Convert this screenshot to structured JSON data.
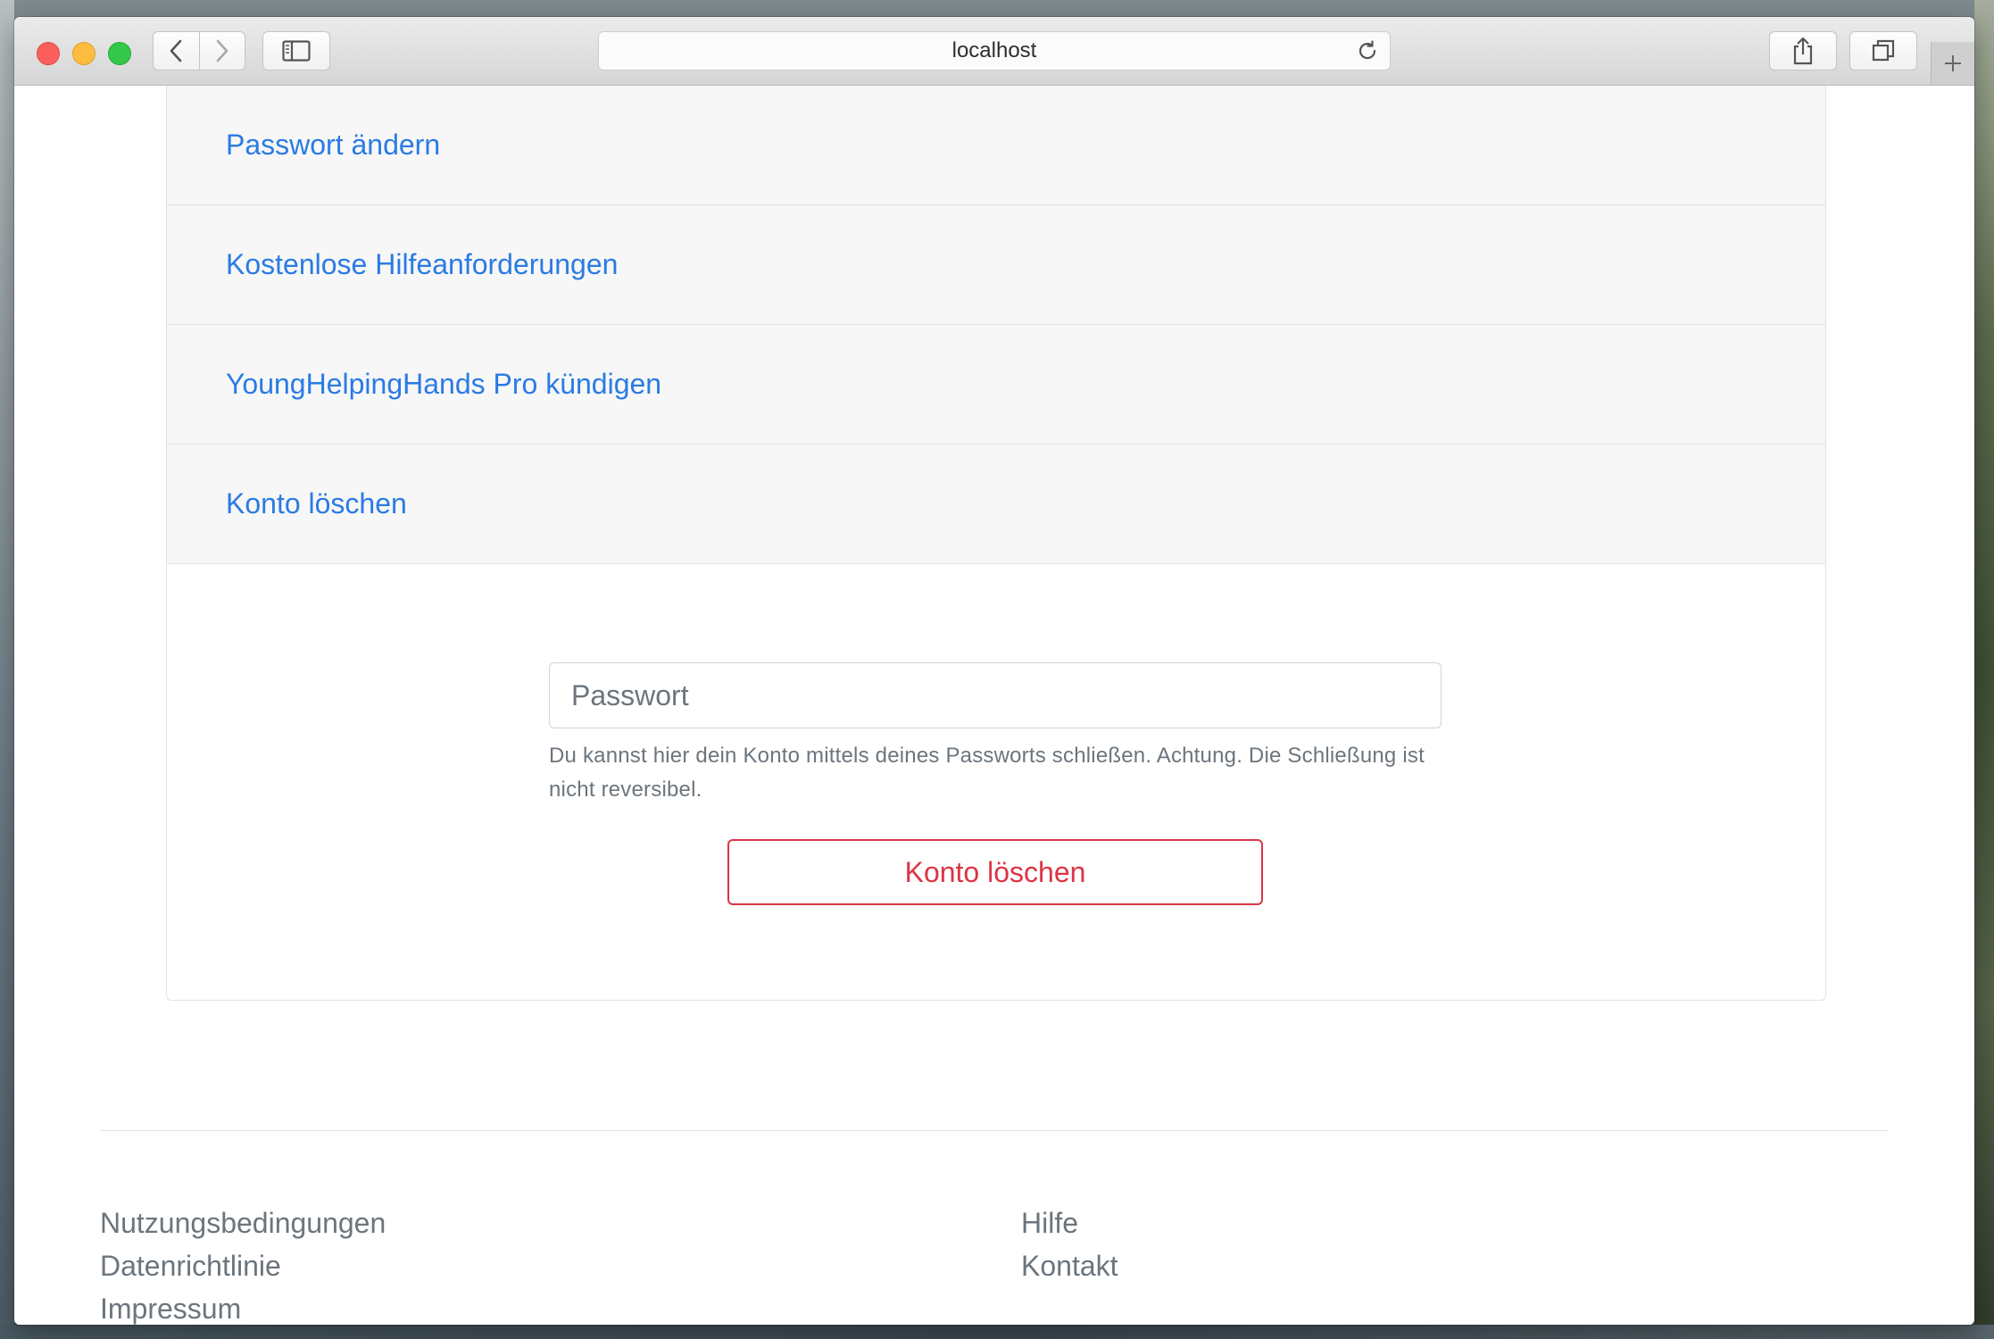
{
  "browser": {
    "address": "localhost",
    "icons": {
      "back": "chevron-left-icon",
      "forward": "chevron-right-icon",
      "sidebar": "sidebar-icon",
      "reload": "reload-icon",
      "share": "share-icon",
      "tabs": "tabs-icon",
      "new_tab": "plus-icon"
    }
  },
  "accordion": {
    "items": [
      {
        "label": "Passwort ändern"
      },
      {
        "label": "Kostenlose Hilfeanforderungen"
      },
      {
        "label": "YoungHelpingHands Pro kündigen"
      },
      {
        "label": "Konto löschen"
      }
    ]
  },
  "delete_account": {
    "password_placeholder": "Passwort",
    "help_text": "Du kannst hier dein Konto mittels deines Passworts schließen. Achtung. Die Schließung ist nicht reversibel.",
    "button_label": "Konto löschen"
  },
  "footer": {
    "left_links": [
      "Nutzungsbedingungen",
      "Datenrichtlinie",
      "Impressum"
    ],
    "right_links": [
      "Hilfe",
      "Kontakt"
    ]
  },
  "colors": {
    "link": "#2a7be4",
    "danger": "#dc3545",
    "muted": "#6c757d"
  }
}
